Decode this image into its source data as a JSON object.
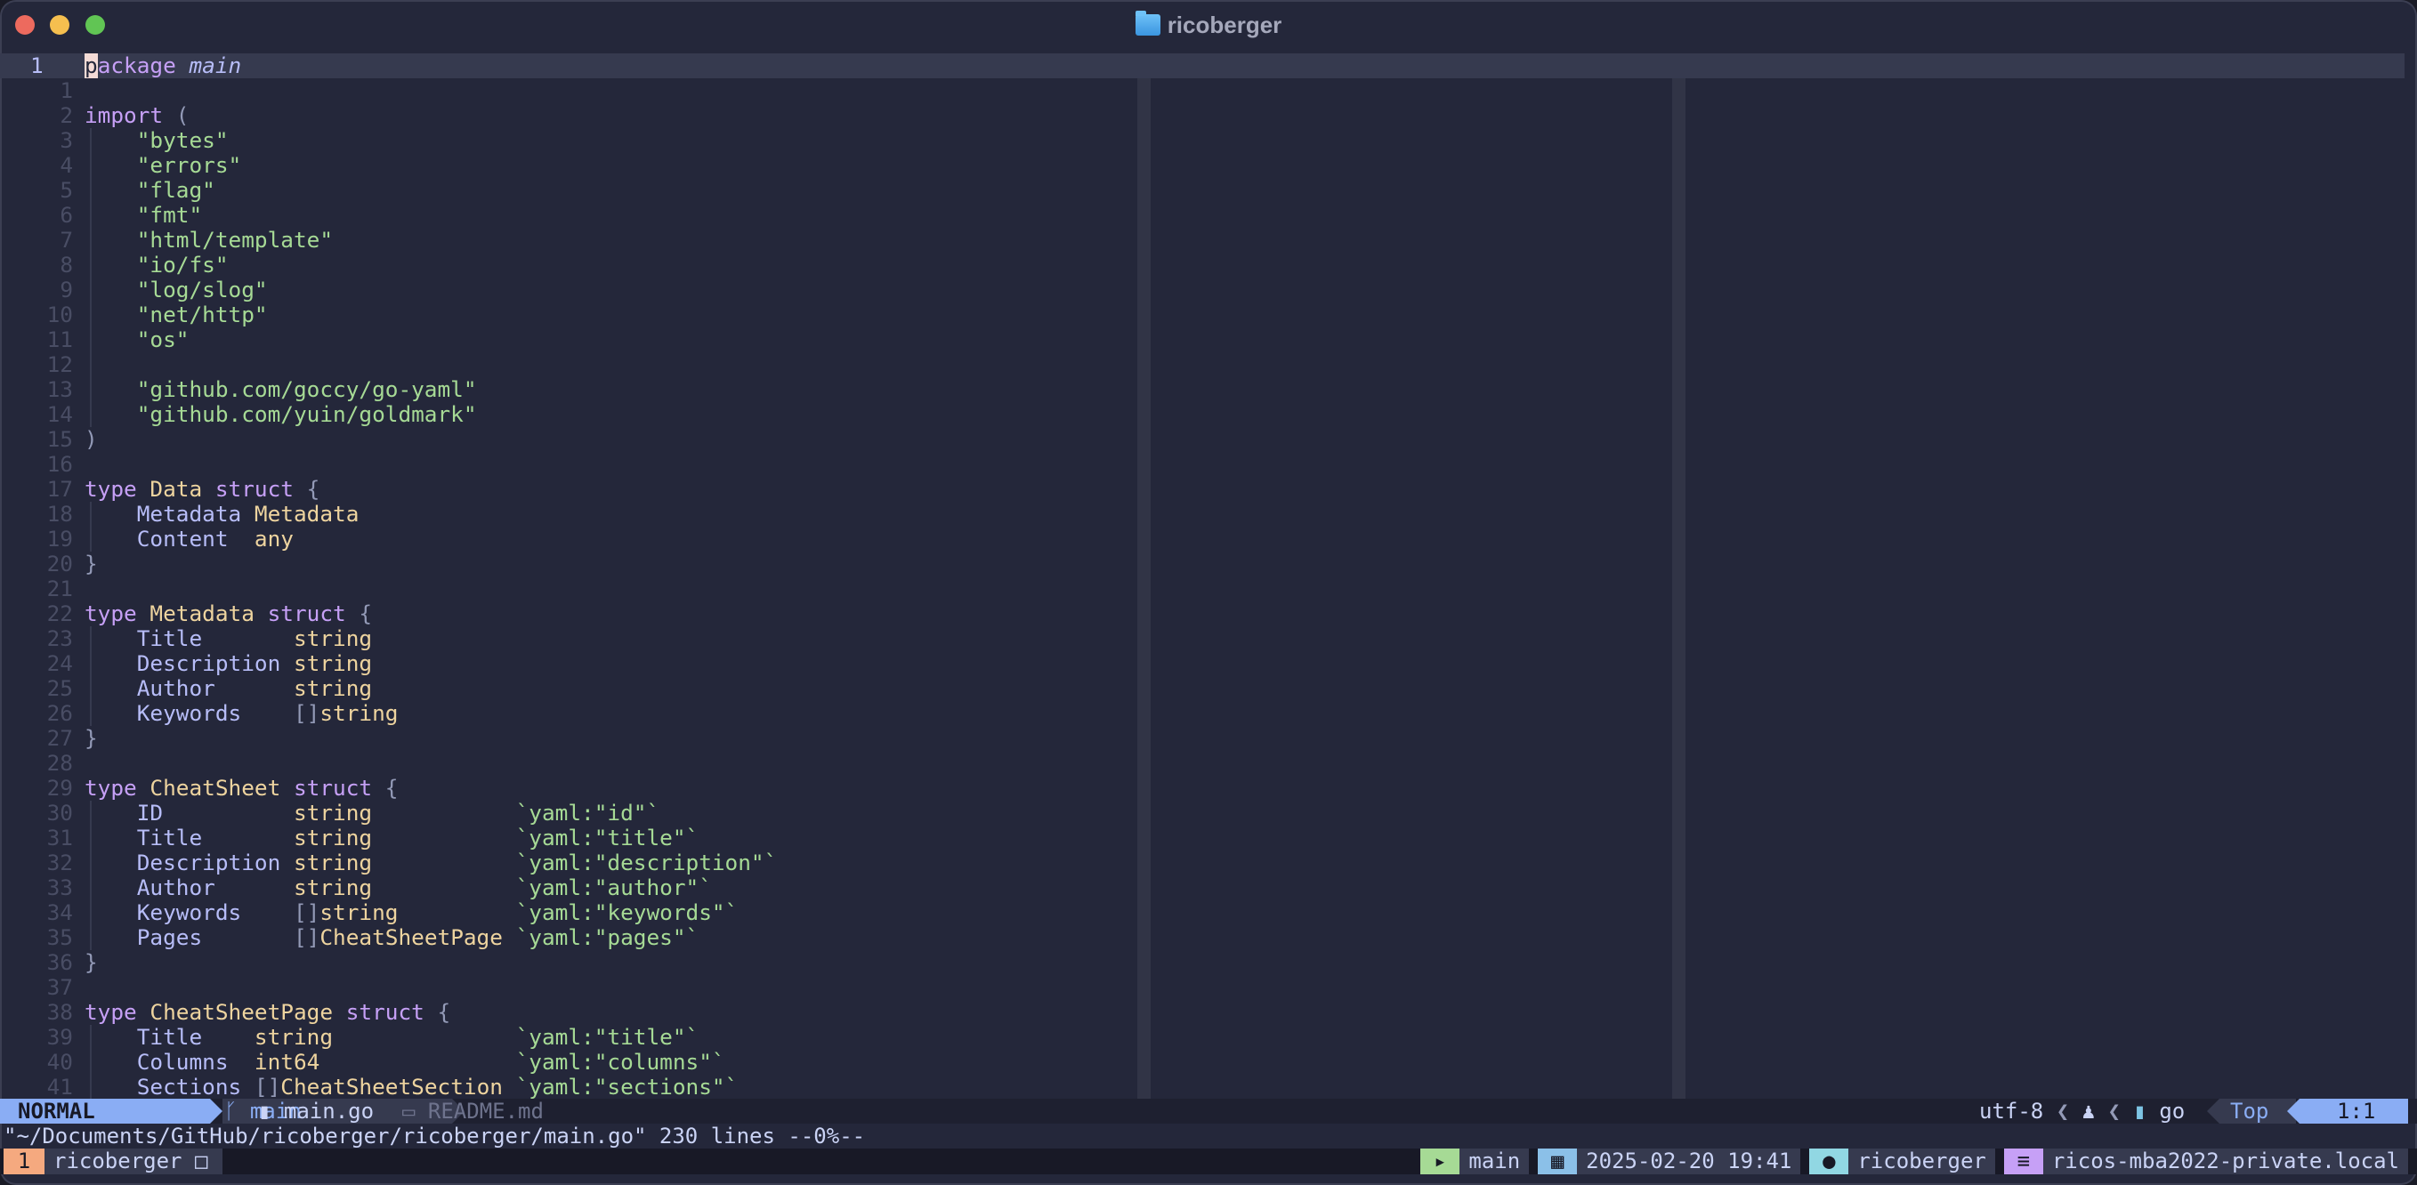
{
  "window": {
    "title": "ricoberger",
    "folder_icon": "folder-icon"
  },
  "colors": {
    "background": "#24273a",
    "keyword": "#c6a0f6",
    "type": "#eed49f",
    "string": "#a6da95",
    "field": "#b7bdf8",
    "mode_normal": "#8aadf4"
  },
  "editor": {
    "current_line_number": "1",
    "lines": [
      {
        "num": "1",
        "tokens": [
          [
            "k",
            "package"
          ],
          [
            "",
            ""
          ],
          [
            "n",
            " main"
          ]
        ]
      },
      {
        "num": "1",
        "tokens": []
      },
      {
        "num": "2",
        "tokens": [
          [
            "k",
            "import"
          ],
          [
            "p",
            " ("
          ]
        ]
      },
      {
        "num": "3",
        "g": 1,
        "tokens": [
          [
            "",
            "    "
          ],
          [
            "s",
            "\"bytes\""
          ]
        ]
      },
      {
        "num": "4",
        "g": 1,
        "tokens": [
          [
            "",
            "    "
          ],
          [
            "s",
            "\"errors\""
          ]
        ]
      },
      {
        "num": "5",
        "g": 1,
        "tokens": [
          [
            "",
            "    "
          ],
          [
            "s",
            "\"flag\""
          ]
        ]
      },
      {
        "num": "6",
        "g": 1,
        "tokens": [
          [
            "",
            "    "
          ],
          [
            "s",
            "\"fmt\""
          ]
        ]
      },
      {
        "num": "7",
        "g": 1,
        "tokens": [
          [
            "",
            "    "
          ],
          [
            "s",
            "\"html/template\""
          ]
        ]
      },
      {
        "num": "8",
        "g": 1,
        "tokens": [
          [
            "",
            "    "
          ],
          [
            "s",
            "\"io/fs\""
          ]
        ]
      },
      {
        "num": "9",
        "g": 1,
        "tokens": [
          [
            "",
            "    "
          ],
          [
            "s",
            "\"log/slog\""
          ]
        ]
      },
      {
        "num": "10",
        "g": 1,
        "tokens": [
          [
            "",
            "    "
          ],
          [
            "s",
            "\"net/http\""
          ]
        ]
      },
      {
        "num": "11",
        "g": 1,
        "tokens": [
          [
            "",
            "    "
          ],
          [
            "s",
            "\"os\""
          ]
        ]
      },
      {
        "num": "12",
        "g": 1,
        "tokens": []
      },
      {
        "num": "13",
        "g": 1,
        "tokens": [
          [
            "",
            "    "
          ],
          [
            "s",
            "\"github.com/goccy/go-yaml\""
          ]
        ]
      },
      {
        "num": "14",
        "g": 1,
        "tokens": [
          [
            "",
            "    "
          ],
          [
            "s",
            "\"github.com/yuin/goldmark\""
          ]
        ]
      },
      {
        "num": "15",
        "tokens": [
          [
            "p",
            ")"
          ]
        ]
      },
      {
        "num": "16",
        "tokens": []
      },
      {
        "num": "17",
        "tokens": [
          [
            "k",
            "type"
          ],
          [
            "t",
            " Data"
          ],
          [
            "k",
            " struct"
          ],
          [
            "p",
            " {"
          ]
        ]
      },
      {
        "num": "18",
        "g": 1,
        "tokens": [
          [
            "",
            "    "
          ],
          [
            "f",
            "Metadata "
          ],
          [
            "t",
            "Metadata"
          ]
        ]
      },
      {
        "num": "19",
        "g": 1,
        "tokens": [
          [
            "",
            "    "
          ],
          [
            "f",
            "Content  "
          ],
          [
            "t",
            "any"
          ]
        ]
      },
      {
        "num": "20",
        "tokens": [
          [
            "p",
            "}"
          ]
        ]
      },
      {
        "num": "21",
        "tokens": []
      },
      {
        "num": "22",
        "tokens": [
          [
            "k",
            "type"
          ],
          [
            "t",
            " Metadata"
          ],
          [
            "k",
            " struct"
          ],
          [
            "p",
            " {"
          ]
        ]
      },
      {
        "num": "23",
        "g": 1,
        "tokens": [
          [
            "",
            "    "
          ],
          [
            "f",
            "Title       "
          ],
          [
            "t",
            "string"
          ]
        ]
      },
      {
        "num": "24",
        "g": 1,
        "tokens": [
          [
            "",
            "    "
          ],
          [
            "f",
            "Description "
          ],
          [
            "t",
            "string"
          ]
        ]
      },
      {
        "num": "25",
        "g": 1,
        "tokens": [
          [
            "",
            "    "
          ],
          [
            "f",
            "Author      "
          ],
          [
            "t",
            "string"
          ]
        ]
      },
      {
        "num": "26",
        "g": 1,
        "tokens": [
          [
            "",
            "    "
          ],
          [
            "f",
            "Keywords    "
          ],
          [
            "p",
            "[]"
          ],
          [
            "t",
            "string"
          ]
        ]
      },
      {
        "num": "27",
        "tokens": [
          [
            "p",
            "}"
          ]
        ]
      },
      {
        "num": "28",
        "tokens": []
      },
      {
        "num": "29",
        "tokens": [
          [
            "k",
            "type"
          ],
          [
            "t",
            " CheatSheet"
          ],
          [
            "k",
            " struct"
          ],
          [
            "p",
            " {"
          ]
        ]
      },
      {
        "num": "30",
        "g": 1,
        "tokens": [
          [
            "",
            "    "
          ],
          [
            "f",
            "ID          "
          ],
          [
            "t",
            "string           "
          ],
          [
            "s",
            "`yaml:\"id\"`"
          ]
        ]
      },
      {
        "num": "31",
        "g": 1,
        "tokens": [
          [
            "",
            "    "
          ],
          [
            "f",
            "Title       "
          ],
          [
            "t",
            "string           "
          ],
          [
            "s",
            "`yaml:\"title\"`"
          ]
        ]
      },
      {
        "num": "32",
        "g": 1,
        "tokens": [
          [
            "",
            "    "
          ],
          [
            "f",
            "Description "
          ],
          [
            "t",
            "string           "
          ],
          [
            "s",
            "`yaml:\"description\"`"
          ]
        ]
      },
      {
        "num": "33",
        "g": 1,
        "tokens": [
          [
            "",
            "    "
          ],
          [
            "f",
            "Author      "
          ],
          [
            "t",
            "string           "
          ],
          [
            "s",
            "`yaml:\"author\"`"
          ]
        ]
      },
      {
        "num": "34",
        "g": 1,
        "tokens": [
          [
            "",
            "    "
          ],
          [
            "f",
            "Keywords    "
          ],
          [
            "p",
            "[]"
          ],
          [
            "t",
            "string         "
          ],
          [
            "s",
            "`yaml:\"keywords\"`"
          ]
        ]
      },
      {
        "num": "35",
        "g": 1,
        "tokens": [
          [
            "",
            "    "
          ],
          [
            "f",
            "Pages       "
          ],
          [
            "p",
            "[]"
          ],
          [
            "t",
            "CheatSheetPage "
          ],
          [
            "s",
            "`yaml:\"pages\"`"
          ]
        ]
      },
      {
        "num": "36",
        "tokens": [
          [
            "p",
            "}"
          ]
        ]
      },
      {
        "num": "37",
        "tokens": []
      },
      {
        "num": "38",
        "tokens": [
          [
            "k",
            "type"
          ],
          [
            "t",
            " CheatSheetPage"
          ],
          [
            "k",
            " struct"
          ],
          [
            "p",
            " {"
          ]
        ]
      },
      {
        "num": "39",
        "g": 1,
        "tokens": [
          [
            "",
            "    "
          ],
          [
            "f",
            "Title    "
          ],
          [
            "t",
            "string              "
          ],
          [
            "s",
            "`yaml:\"title\"`"
          ]
        ]
      },
      {
        "num": "40",
        "g": 1,
        "tokens": [
          [
            "",
            "    "
          ],
          [
            "f",
            "Columns  "
          ],
          [
            "t",
            "int64               "
          ],
          [
            "s",
            "`yaml:\"columns\"`"
          ]
        ]
      },
      {
        "num": "41",
        "g": 1,
        "tokens": [
          [
            "",
            "    "
          ],
          [
            "f",
            "Sections "
          ],
          [
            "p",
            "[]"
          ],
          [
            "t",
            "CheatSheetSection "
          ],
          [
            "s",
            "`yaml:\"sections\"`"
          ]
        ]
      }
    ]
  },
  "statusline": {
    "mode": "NORMAL",
    "branch_icon": "git-branch-icon",
    "branch": "main",
    "buffers": [
      {
        "icon": "go-file-icon",
        "name": "main.go",
        "active": true
      },
      {
        "icon": "markdown-file-icon",
        "name": "README.md",
        "active": false
      }
    ],
    "encoding": "utf-8",
    "os_icon": "linux-icon",
    "filetype_icon": "go-icon",
    "filetype": "go",
    "position": "Top",
    "cursor": "1:1"
  },
  "cmdline": {
    "message": "\"~/Documents/GitHub/ricoberger/ricoberger/main.go\" 230 lines --0%--"
  },
  "tmux": {
    "window_index": "1",
    "window_name": "ricoberger",
    "window_flag": "□",
    "right": [
      {
        "icon": "terminal-icon",
        "text": "main",
        "color": "#a6da95"
      },
      {
        "icon": "calendar-icon",
        "text": "2025-02-20 19:41",
        "color": "#8bc0e8"
      },
      {
        "icon": "user-icon",
        "text": "ricoberger",
        "color": "#91d7e3"
      },
      {
        "icon": "server-icon",
        "text": "ricos-mba2022-private.local",
        "color": "#c6a0f6"
      }
    ]
  }
}
